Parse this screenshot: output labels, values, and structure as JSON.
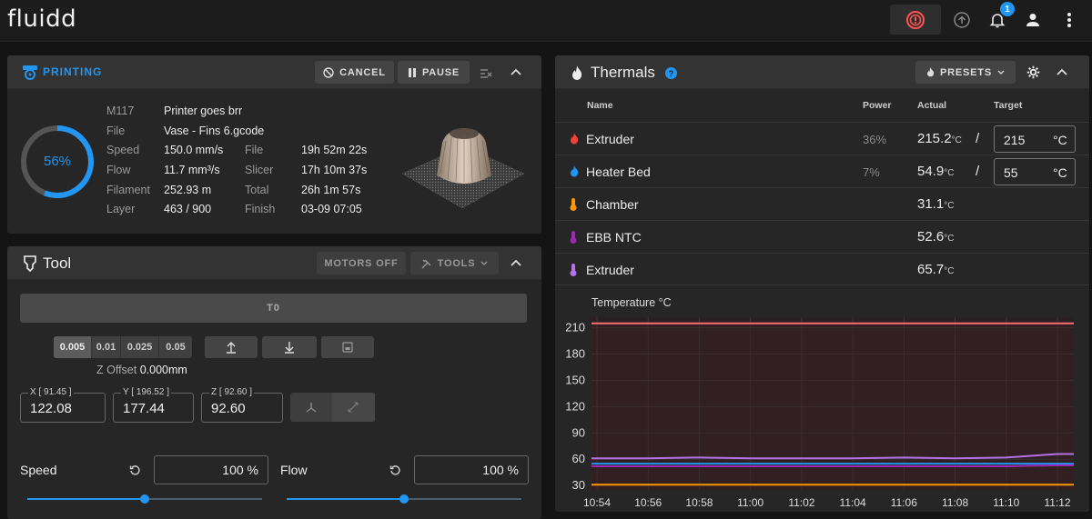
{
  "app": {
    "logo": "fluidd",
    "notification_count": "1"
  },
  "printing": {
    "title": "PRINTING",
    "cancel_label": "CANCEL",
    "pause_label": "PAUSE",
    "progress_text": "56%",
    "progress_fraction": 0.56,
    "message_label": "M117",
    "message_value": "Printer goes brr",
    "file_label": "File",
    "file_value": "Vase - Fins 6.gcode",
    "left_stats": [
      {
        "label": "Speed",
        "value": "150.0 mm/s"
      },
      {
        "label": "Flow",
        "value": "11.7 mm³/s"
      },
      {
        "label": "Filament",
        "value": "252.93 m"
      },
      {
        "label": "Layer",
        "value": "463 / 900"
      }
    ],
    "right_stats": [
      {
        "label": "File",
        "value": "19h 52m 22s"
      },
      {
        "label": "Slicer",
        "value": "17h 10m 37s"
      },
      {
        "label": "Total",
        "value": "26h 1m 57s"
      },
      {
        "label": "Finish",
        "value": "03-09 07:05"
      }
    ]
  },
  "tool": {
    "title": "Tool",
    "motors_off_label": "MOTORS OFF",
    "tools_label": "TOOLS",
    "toolhead_label": "T0",
    "z_steps": [
      "0.005",
      "0.01",
      "0.025",
      "0.05"
    ],
    "z_offset_label": "Z Offset",
    "z_offset_value": "0.000mm",
    "x": {
      "label": "X [ 91.45 ]",
      "value": "122.08"
    },
    "y": {
      "label": "Y [ 196.52 ]",
      "value": "177.44"
    },
    "z": {
      "label": "Z [ 92.60 ]",
      "value": "92.60"
    },
    "speed_label": "Speed",
    "speed_value": "100 %",
    "speed_level": 1.0,
    "flow_label": "Flow",
    "flow_value": "100 %",
    "flow_level": 1.0
  },
  "thermals": {
    "title": "Thermals",
    "presets_label": "PRESETS",
    "headers": {
      "name": "Name",
      "power": "Power",
      "actual": "Actual",
      "target": "Target"
    },
    "rows": [
      {
        "name": "Extruder",
        "icon": "flame-icon",
        "color": "#f44336",
        "power": "36%",
        "actual": "215.2",
        "unit": "°C",
        "target": "215"
      },
      {
        "name": "Heater Bed",
        "icon": "flame-icon",
        "color": "#2196f3",
        "power": "7%",
        "actual": "54.9",
        "unit": "°C",
        "target": "55"
      },
      {
        "name": "Chamber",
        "icon": "thermometer-icon",
        "color": "#ff9800",
        "power": "",
        "actual": "31.1",
        "unit": "°C",
        "target": ""
      },
      {
        "name": "EBB NTC",
        "icon": "thermometer-icon",
        "color": "#9c27b0",
        "power": "",
        "actual": "52.6",
        "unit": "°C",
        "target": ""
      },
      {
        "name": "Extruder",
        "icon": "thermometer-icon",
        "color": "#b472e6",
        "power": "",
        "actual": "65.7",
        "unit": "°C",
        "target": ""
      }
    ],
    "target_unit": "°C"
  },
  "chart_data": {
    "type": "line",
    "title": "Temperature °C",
    "x": [
      "10:54",
      "10:56",
      "10:58",
      "11:00",
      "11:02",
      "11:04",
      "11:06",
      "11:08",
      "11:10",
      "11:12"
    ],
    "ylim": [
      25,
      222
    ],
    "yticks": [
      30,
      60,
      90,
      120,
      150,
      180,
      210
    ],
    "xticks": [
      "10:54",
      "10:56",
      "10:58",
      "11:00",
      "11:02",
      "11:04",
      "11:06",
      "11:08",
      "11:10",
      "11:12"
    ],
    "series": [
      {
        "color": "#ff6e6e",
        "values": [
          215,
          215,
          215,
          215,
          215,
          215,
          215,
          215,
          215,
          215
        ],
        "target": 215
      },
      {
        "color": "#b472e6",
        "values": [
          61,
          61,
          62,
          61,
          61,
          61,
          62,
          61,
          62,
          66
        ]
      },
      {
        "color": "#2196f3",
        "values": [
          55,
          55,
          55,
          55,
          55,
          55,
          55,
          55,
          55,
          55
        ]
      },
      {
        "color": "#9c27b0",
        "values": [
          52,
          52,
          52,
          52,
          52,
          52,
          52,
          52,
          52,
          53
        ]
      },
      {
        "color": "#ff9800",
        "values": [
          31,
          31,
          31,
          31,
          31,
          31,
          31,
          31,
          31,
          31
        ]
      }
    ]
  }
}
